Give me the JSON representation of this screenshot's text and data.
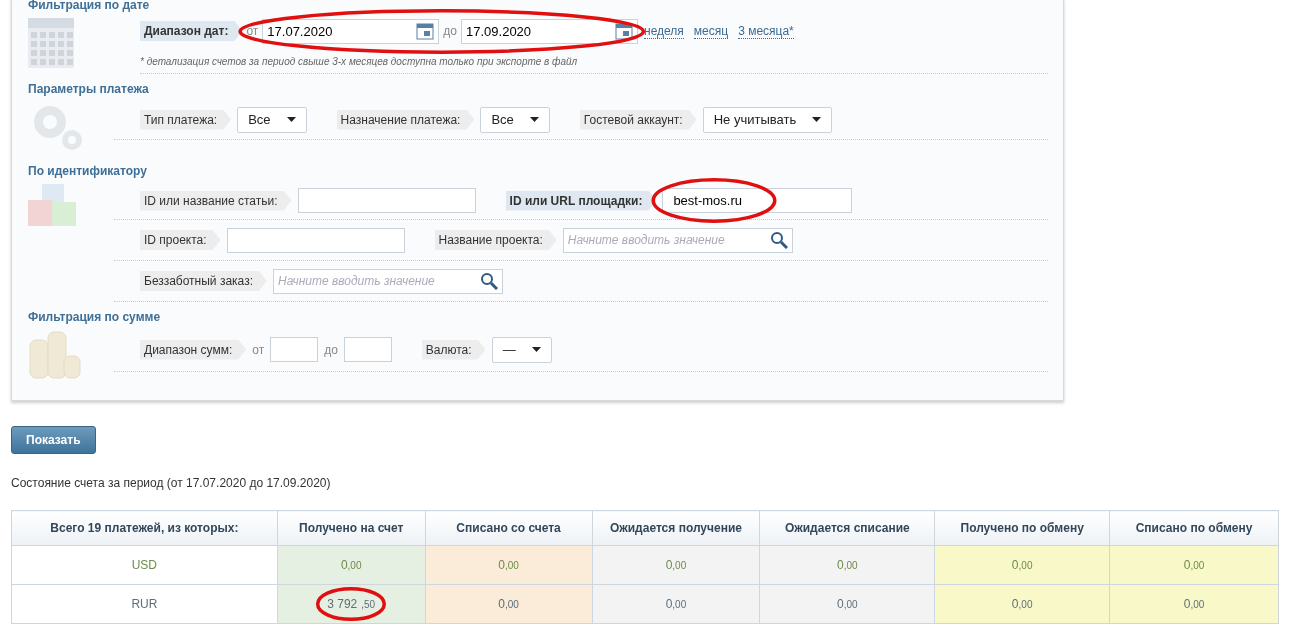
{
  "filters": {
    "date": {
      "title": "Фильтрация по дате",
      "label": "Диапазон дат:",
      "from_label": "от",
      "from": "17.07.2020",
      "to_label": "до",
      "to": "17.09.2020",
      "presets": [
        "неделя",
        "месяц",
        "3 месяца*"
      ],
      "note": "* детализация счетов за период свыше 3-х месяцев доступна только при экспорте в файл"
    },
    "payment": {
      "title": "Параметры платежа",
      "selects": [
        {
          "label": "Тип платежа:",
          "value": "Все"
        },
        {
          "label": "Назначение платежа:",
          "value": "Все"
        },
        {
          "label": "Гостевой аккаунт:",
          "value": "Не учитывать"
        }
      ]
    },
    "identifier": {
      "title": "По идентификатору",
      "rows": [
        [
          {
            "label": "ID или название статьи:",
            "kind": "text",
            "bold": false
          },
          {
            "label": "ID или URL площадки:",
            "kind": "text",
            "value": "best-mos.ru",
            "bold": true
          }
        ],
        [
          {
            "label": "ID проекта:",
            "kind": "text",
            "bold": false
          },
          {
            "label": "Название проекта:",
            "kind": "search",
            "placeholder": "Начните вводить значение",
            "bold": false
          }
        ],
        [
          {
            "label": "Беззаботный заказ:",
            "kind": "search",
            "placeholder": "Начните вводить значение",
            "bold": false
          }
        ]
      ]
    },
    "sum": {
      "title": "Фильтрация по сумме",
      "label": "Диапазон сумм:",
      "from_label": "от",
      "to_label": "до",
      "currency_label": "Валюта:",
      "currency": "—"
    }
  },
  "show_button": "Показать",
  "period_text": "Состояние счета за период (от 17.07.2020 до 17.09.2020)",
  "table": {
    "columns": [
      {
        "title": "Всего 19 платежей, из которых:",
        "color": "#ffffff"
      },
      {
        "title": "Получено на счет",
        "color": "#e6f0e2"
      },
      {
        "title": "Списано со счета",
        "color": "#faecd9"
      },
      {
        "title": "Ожидается получение",
        "color": "#f3f3f3"
      },
      {
        "title": "Ожидается списание",
        "color": "#f3f3f3"
      },
      {
        "title": "Получено по обмену",
        "color": "#f9f8c9"
      },
      {
        "title": "Списано по обмену",
        "color": "#f9f8c9"
      }
    ],
    "rows": [
      {
        "currency": "USD",
        "color": "#6f8a4a",
        "values": [
          {
            "int": "0",
            "frac": ",00"
          },
          {
            "int": "0",
            "frac": ",00"
          },
          {
            "int": "0",
            "frac": ",00"
          },
          {
            "int": "0",
            "frac": ",00"
          },
          {
            "int": "0",
            "frac": ",00"
          },
          {
            "int": "0",
            "frac": ",00"
          }
        ]
      },
      {
        "currency": "RUR",
        "color": "#5e6e78",
        "values": [
          {
            "int": "3 792",
            "frac": ",50"
          },
          {
            "int": "0",
            "frac": ",00"
          },
          {
            "int": "0",
            "frac": ",00"
          },
          {
            "int": "0",
            "frac": ",00"
          },
          {
            "int": "0",
            "frac": ",00"
          },
          {
            "int": "0",
            "frac": ",00"
          }
        ]
      }
    ]
  },
  "annotations": [
    {
      "kind": "ellipse"
    },
    {
      "kind": "ellipse"
    },
    {
      "kind": "ellipse"
    }
  ]
}
